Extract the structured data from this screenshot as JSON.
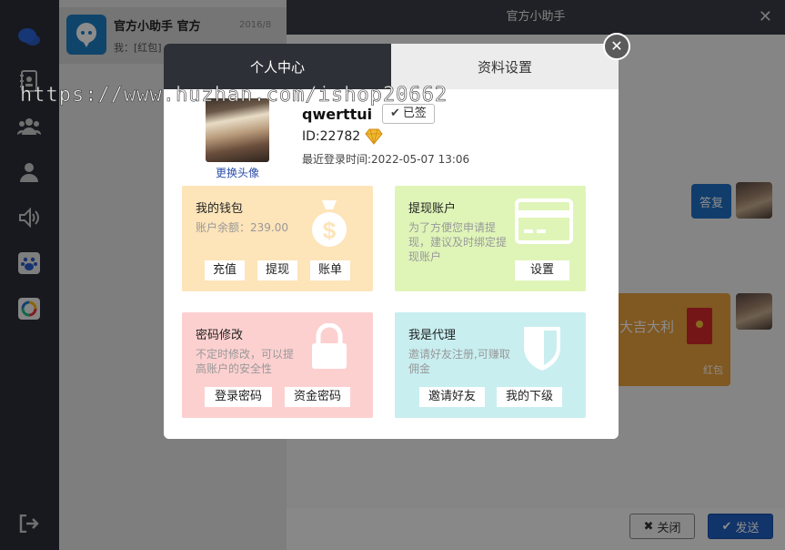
{
  "conversation": {
    "title": "官方小助手 官方",
    "time": "2016/8",
    "last_message": "我：[红包]"
  },
  "chat": {
    "title": "官方小助手",
    "reply_label": "答复",
    "redpack_text": "大吉大利",
    "redpack_label": "红包",
    "close_label": "关闭",
    "send_label": "发送"
  },
  "modal": {
    "tabs": [
      {
        "label": "个人中心"
      },
      {
        "label": "资料设置"
      }
    ],
    "profile": {
      "change_avatar": "更换头像",
      "username": "qwerttui",
      "signed_label": "已签",
      "id": "ID:22782",
      "last_login": "最近登录时间:2022-05-07 13:06"
    },
    "cards": {
      "wallet": {
        "title": "我的钱包",
        "desc": "账户余额：239.00",
        "buttons": [
          "充值",
          "提现",
          "账单"
        ]
      },
      "withdraw": {
        "title": "提现账户",
        "desc": "为了方便您申请提现，建议及时绑定提现账户",
        "buttons": [
          "设置"
        ]
      },
      "password": {
        "title": "密码修改",
        "desc": "不定时修改，可以提高账户的安全性",
        "buttons": [
          "登录密码",
          "资金密码"
        ]
      },
      "agent": {
        "title": "我是代理",
        "desc": "邀请好友注册,可赚取佣金",
        "buttons": [
          "邀请好友",
          "我的下级"
        ]
      }
    }
  },
  "watermark": "https://www.huzhan.com/ishop20662",
  "colors": {
    "rail": "#2b2f38",
    "accent": "#1f5fc2",
    "tab_active": "#2d3036"
  }
}
